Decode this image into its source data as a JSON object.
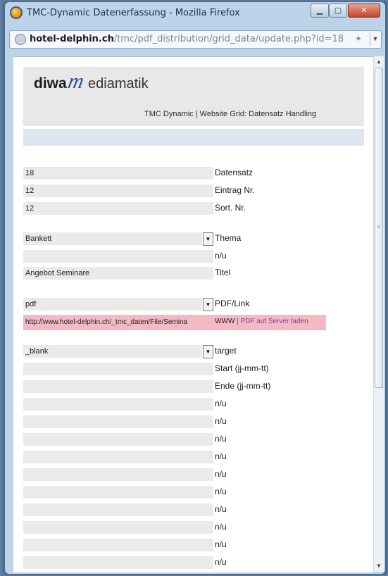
{
  "window": {
    "title": "TMC-Dynamic Datenerfassung - Mozilla Firefox",
    "buttons": {
      "minimize": "▁",
      "maximize": "▢",
      "close": "✕"
    }
  },
  "address_bar": {
    "domain": "hotel-delphin.ch",
    "path": "/tmc/pdf_distribution/grid_data/update.php?id=18"
  },
  "header": {
    "logo_brand": "diwa",
    "logo_m": "m",
    "logo_rest": "ediamatik",
    "subtitle": "TMC Dynamic | Website Grid: Datensatz Handling"
  },
  "record_fields": [
    {
      "value": "18",
      "label": "Datensatz"
    },
    {
      "value": "12",
      "label": "Eintrag Nr."
    },
    {
      "value": "12",
      "label": "Sort. Nr."
    }
  ],
  "thema": {
    "value": "Bankett",
    "label": "Thema"
  },
  "nu_after_thema": {
    "value": "",
    "label": "n/u"
  },
  "titel": {
    "value": "Angebot Seminare",
    "label": "Titel"
  },
  "pdf_link": {
    "value": "pdf",
    "label": "PDF/Link"
  },
  "url_row": {
    "value": "http://www.hotel-delphin.ch/_tmc_daten/File/Semina",
    "www": "WWW",
    "separator": " | ",
    "pdf_upload": "PDF auf Server laden"
  },
  "target": {
    "value": "_blank",
    "label": "target"
  },
  "start": {
    "value": "",
    "label": "Start (jj-mm-tt)"
  },
  "ende": {
    "value": "",
    "label": "Ende (jj-mm-tt)"
  },
  "nu_fields": [
    {
      "value": "",
      "label": "n/u"
    },
    {
      "value": "",
      "label": "n/u"
    },
    {
      "value": "",
      "label": "n/u"
    },
    {
      "value": "",
      "label": "n/u"
    },
    {
      "value": "",
      "label": "n/u"
    },
    {
      "value": "",
      "label": "n/u"
    },
    {
      "value": "",
      "label": "n/u"
    },
    {
      "value": "",
      "label": "n/u"
    },
    {
      "value": "",
      "label": "n/u"
    },
    {
      "value": "",
      "label": "n/u"
    }
  ]
}
